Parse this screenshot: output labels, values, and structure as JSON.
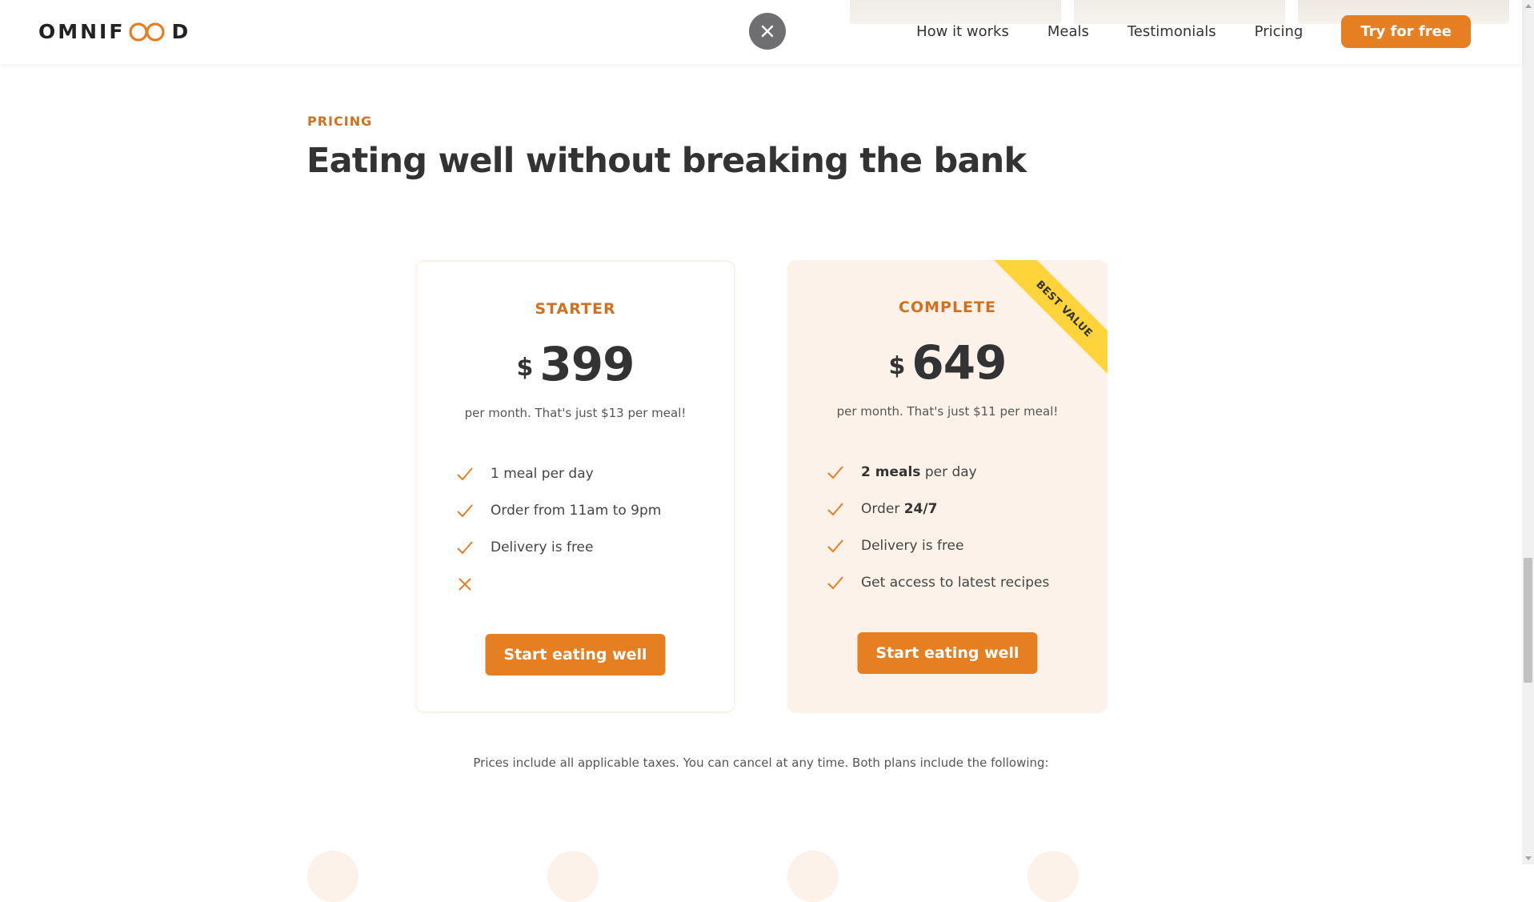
{
  "header": {
    "logo_text_start": "OMNIF",
    "logo_text_end": "D",
    "nav": [
      {
        "label": "How it works"
      },
      {
        "label": "Meals"
      },
      {
        "label": "Testimonials"
      },
      {
        "label": "Pricing"
      }
    ],
    "cta_label": "Try for free",
    "close_icon": "close-icon"
  },
  "section": {
    "subheading": "PRICING",
    "heading": "Eating well without breaking the bank"
  },
  "plans": [
    {
      "name": "STARTER",
      "currency": "$",
      "amount": "399",
      "note": "per month. That's just $13 per meal!",
      "features": [
        {
          "icon": "checkmark-icon",
          "bold": "",
          "text": "1 meal per day",
          "suffix": ""
        },
        {
          "icon": "checkmark-icon",
          "bold": "",
          "text": "Order from 11am to 9pm",
          "suffix": ""
        },
        {
          "icon": "checkmark-icon",
          "bold": "",
          "text": "Delivery is free",
          "suffix": ""
        },
        {
          "icon": "cross-icon",
          "bold": "",
          "text": "",
          "suffix": ""
        }
      ],
      "cta_label": "Start eating well"
    },
    {
      "name": "COMPLETE",
      "currency": "$",
      "amount": "649",
      "note": "per month. That's just $11 per meal!",
      "ribbon": "BEST VALUE",
      "features": [
        {
          "icon": "checkmark-icon",
          "bold": "2 meals",
          "text": " per day",
          "suffix": ""
        },
        {
          "icon": "checkmark-icon",
          "bold": "",
          "text": "Order ",
          "suffix": "24/7"
        },
        {
          "icon": "checkmark-icon",
          "bold": "",
          "text": "Delivery is free",
          "suffix": ""
        },
        {
          "icon": "checkmark-icon",
          "bold": "",
          "text": "Get access to latest recipes",
          "suffix": ""
        }
      ],
      "cta_label": "Start eating well"
    }
  ],
  "footnote": "Prices include all applicable taxes. You can cancel at any time. Both plans include the following:",
  "colors": {
    "accent": "#e67e22",
    "accent_dark": "#cf711f",
    "tint": "#fdf2e9",
    "ribbon": "#ffd43b"
  }
}
